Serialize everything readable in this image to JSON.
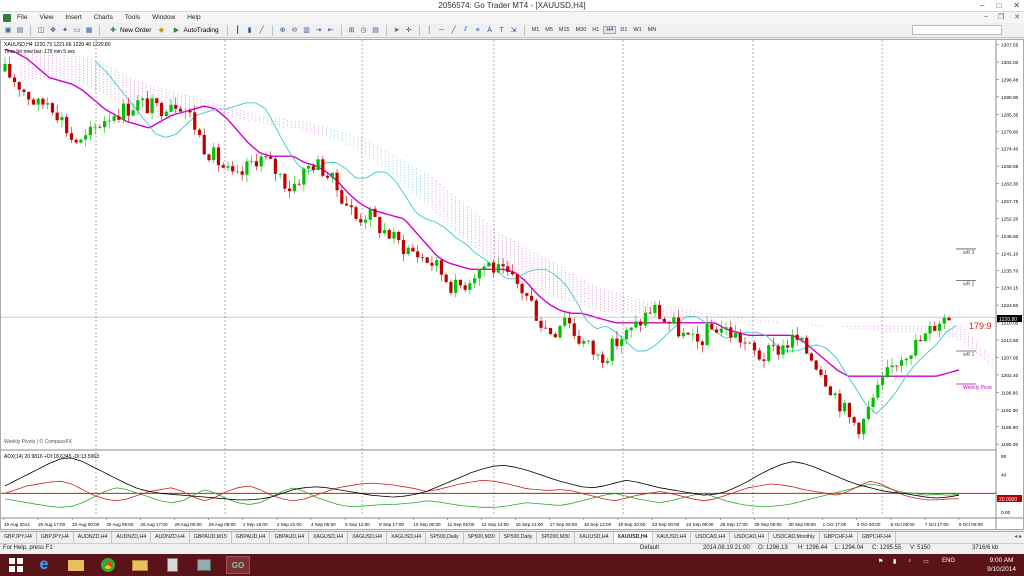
{
  "window": {
    "title": "2056574: Go Trader MT4 - [XAUUSD,H4]"
  },
  "menu": {
    "items": [
      "File",
      "View",
      "Insert",
      "Charts",
      "Tools",
      "Window",
      "Help"
    ]
  },
  "toolbar": {
    "new_order_label": "New Order",
    "autotrading_label": "AutoTrading",
    "timeframes": [
      "M1",
      "M5",
      "M15",
      "M30",
      "H1",
      "H4",
      "D1",
      "W1",
      "MN"
    ],
    "active_timeframe": "H4"
  },
  "chart": {
    "symbol_header": "XAUUSD,H4  1220.73  1221.66  1220.40  1220.80",
    "timer_text": "Time for new bar: 179 min 5 sec",
    "watermark": "Weekly Pivots | © CompassFX",
    "countdown_label": "179:9",
    "current_price_label": "1220.80",
    "pivot_labels": [
      "wR 3",
      "wR 2",
      "wR 1",
      "Weekly Pivot"
    ],
    "indicator_header": "ADX(14) 20.9816  +DI:18.6345  -DI:13.5963",
    "indicator_level_label": "20.0000"
  },
  "chart_data": {
    "type": "candlestick",
    "symbol": "XAUUSD",
    "timeframe": "H4",
    "price_axis": {
      "ticks": [
        "1307.55",
        "1302.00",
        "1296.48",
        "1290.90",
        "1285.35",
        "1279.80",
        "1274.40",
        "1268.85",
        "1263.30",
        "1257.75",
        "1252.20",
        "1246.60",
        "1241.10",
        "1235.70",
        "1230.15",
        "1224.60",
        "1219.05",
        "1213.50",
        "1207.95",
        "1202.40",
        "1196.85",
        "1191.30",
        "1185.90",
        "1180.35"
      ],
      "range": [
        1178.5,
        1309.0
      ]
    },
    "time_axis": {
      "ticks": [
        "19 Aug 2014",
        "20 Aug 17:00",
        "22 Aug 00:00",
        "25 Aug 09:00",
        "26 Aug 17:00",
        "28 Aug 00:00",
        "29 Aug 09:00",
        "1 Sep 16:00",
        "2 Sep 21:00",
        "4 Sep 05:00",
        "5 Sep 12:00",
        "8 Sep 17:00",
        "10 Sep 00:00",
        "11 Sep 05:00",
        "12 Sep 13:00",
        "15 Sep 21:00",
        "17 Sep 05:00",
        "18 Sep 12:00",
        "19 Sep 20:00",
        "23 Sep 00:00",
        "24 Sep 09:00",
        "25 Sep 17:00",
        "29 Sep 00:00",
        "30 Sep 09:00",
        "1 Oct 17:00",
        "3 Oct 00:00",
        "6 Oct 09:00",
        "7 Oct 17:00",
        "9 Oct 00:00"
      ]
    },
    "indicator_axis": {
      "ticks": [
        "60",
        "40",
        "20.0000",
        "0.00"
      ],
      "range": [
        0,
        60
      ],
      "level": 20
    },
    "series_colors": {
      "bull": "#00c000",
      "bear": "#c00000",
      "kijun": "#d000d0",
      "tenkan": "#40c8c8",
      "cloud_bear": "#d070d0",
      "cloud_bull": "#60c0c0",
      "adx": "#000000",
      "plus_di": "#2aaa2a",
      "minus_di": "#d02020",
      "level": "#b00000"
    },
    "price_anchors": [
      1299,
      1296,
      1292,
      1288,
      1290,
      1285,
      1278,
      1276,
      1280,
      1284,
      1286,
      1287,
      1289,
      1288,
      1287,
      1290,
      1289,
      1284,
      1276,
      1272,
      1268,
      1264,
      1268,
      1272,
      1270,
      1266,
      1262,
      1266,
      1270,
      1268,
      1263,
      1258,
      1252,
      1254,
      1250,
      1247,
      1244,
      1242,
      1240,
      1238,
      1234,
      1230,
      1232,
      1236,
      1238,
      1235,
      1233,
      1230,
      1225,
      1218,
      1216,
      1222,
      1215,
      1212,
      1208,
      1210,
      1214,
      1216,
      1220,
      1224,
      1220,
      1218,
      1214,
      1212,
      1216,
      1218,
      1216,
      1214,
      1210,
      1208,
      1210,
      1212,
      1214,
      1210,
      1206,
      1200,
      1194,
      1188,
      1186,
      1194,
      1200,
      1206,
      1210,
      1212,
      1215,
      1220,
      1221
    ],
    "kijun": [
      1306,
      1305,
      1303,
      1300,
      1297,
      1296,
      1295,
      1293,
      1290,
      1287,
      1285,
      1283,
      1282,
      1281,
      1283,
      1285,
      1286,
      1287,
      1288,
      1287,
      1284,
      1280,
      1276,
      1273,
      1272,
      1272,
      1272,
      1270,
      1269,
      1267,
      1264,
      1260,
      1257,
      1255,
      1254,
      1253,
      1252,
      1248,
      1244,
      1240,
      1238,
      1237,
      1236,
      1236,
      1236,
      1236,
      1235,
      1232,
      1228,
      1225,
      1223,
      1222,
      1222,
      1221,
      1220,
      1219,
      1219,
      1219,
      1219,
      1219,
      1219,
      1219,
      1219,
      1219,
      1219,
      1217,
      1216,
      1215,
      1215,
      1215,
      1215,
      1215,
      1213,
      1210,
      1207,
      1204,
      1202,
      1202,
      1202,
      1202,
      1202,
      1202,
      1202,
      1202,
      1202,
      1203,
      1204
    ],
    "tenkan": [
      1302,
      1299,
      1295,
      1291,
      1287,
      1283,
      1279,
      1278,
      1279,
      1282,
      1285,
      1286,
      1287,
      1287,
      1288,
      1289,
      1289,
      1287,
      1281,
      1275,
      1270,
      1267,
      1268,
      1270,
      1270,
      1268,
      1265,
      1265,
      1267,
      1267,
      1264,
      1259,
      1254,
      1252,
      1251,
      1249,
      1246,
      1244,
      1241,
      1239,
      1236,
      1233,
      1233,
      1235,
      1236,
      1236,
      1234,
      1231,
      1226,
      1220,
      1217,
      1218,
      1216,
      1213,
      1210,
      1210,
      1212,
      1215,
      1218,
      1221,
      1221,
      1219,
      1216,
      1214,
      1215,
      1216,
      1216,
      1215,
      1212,
      1210,
      1210,
      1211,
      1212,
      1211,
      1208,
      1203,
      1198,
      1193,
      1190,
      1193,
      1197,
      1202,
      1206,
      1209,
      1212,
      1216,
      1218
    ],
    "cloud_top": [
      1307,
      1306,
      1305,
      1305,
      1304,
      1304,
      1303,
      1302,
      1300,
      1298,
      1296,
      1295,
      1294,
      1293,
      1292,
      1291,
      1290,
      1289,
      1288,
      1287,
      1286,
      1285,
      1284,
      1284,
      1283,
      1283,
      1282,
      1281,
      1280,
      1279,
      1278,
      1276,
      1274,
      1272,
      1270,
      1268,
      1266,
      1263,
      1260,
      1257,
      1254,
      1251,
      1248,
      1246,
      1244,
      1242,
      1240,
      1238,
      1236,
      1234,
      1232,
      1230,
      1229,
      1228,
      1227,
      1226,
      1225,
      1224,
      1224,
      1223,
      1222,
      1222,
      1221,
      1221,
      1220,
      1220,
      1220,
      1219,
      1219,
      1219,
      1218,
      1218,
      1218,
      1218,
      1218,
      1218,
      1218,
      1218,
      1218,
      1218,
      1218,
      1218,
      1218,
      1218,
      1214,
      1210,
      1206
    ],
    "cloud_bottom": [
      1296,
      1296,
      1297,
      1297,
      1296,
      1295,
      1294,
      1292,
      1290,
      1288,
      1286,
      1285,
      1284,
      1284,
      1285,
      1286,
      1286,
      1286,
      1285,
      1284,
      1283,
      1283,
      1282,
      1281,
      1281,
      1280,
      1279,
      1278,
      1277,
      1275,
      1273,
      1271,
      1268,
      1265,
      1262,
      1259,
      1256,
      1252,
      1249,
      1246,
      1243,
      1240,
      1237,
      1235,
      1233,
      1231,
      1229,
      1227,
      1226,
      1225,
      1224,
      1223,
      1222,
      1222,
      1222,
      1222,
      1221,
      1221,
      1221,
      1221,
      1221,
      1221,
      1220,
      1220,
      1219,
      1219,
      1219,
      1219,
      1219,
      1219,
      1219,
      1218,
      1218,
      1217,
      1217,
      1217,
      1216,
      1216,
      1216,
      1216,
      1215,
      1215,
      1214,
      1213,
      1210,
      1207,
      1204
    ],
    "pivot_levels": {
      "wR3": 1242.5,
      "wR2": 1232.5,
      "wR1": 1210.0,
      "weekly_pivot": 1199.5
    },
    "adx": [
      28,
      34,
      40,
      46,
      52,
      57,
      58,
      54,
      48,
      42,
      36,
      30,
      25,
      22,
      20,
      19,
      18,
      17,
      16,
      15,
      14,
      13,
      13,
      14,
      16,
      20,
      24,
      26,
      27,
      26,
      24,
      22,
      20,
      18,
      17,
      16,
      17,
      19,
      22,
      27,
      32,
      37,
      42,
      46,
      49,
      50,
      48,
      45,
      41,
      37,
      33,
      30,
      27,
      26,
      28,
      31,
      34,
      32,
      29,
      26,
      24,
      22,
      20,
      18,
      19,
      22,
      27,
      33,
      40,
      46,
      51,
      54,
      52,
      48,
      43,
      38,
      33,
      29,
      26,
      23,
      21,
      20,
      18,
      16,
      15,
      16,
      18
    ],
    "plus_di": [
      14,
      12,
      10,
      8,
      6,
      5,
      6,
      10,
      16,
      22,
      26,
      24,
      20,
      16,
      12,
      10,
      12,
      18,
      24,
      20,
      14,
      10,
      8,
      10,
      16,
      22,
      26,
      22,
      16,
      12,
      8,
      6,
      6,
      7,
      8,
      8,
      9,
      10,
      12,
      11,
      9,
      7,
      6,
      5,
      5,
      6,
      8,
      10,
      9,
      8,
      7,
      9,
      12,
      15,
      18,
      20,
      17,
      14,
      12,
      10,
      12,
      15,
      18,
      20,
      16,
      12,
      9,
      7,
      6,
      6,
      7,
      9,
      12,
      15,
      18,
      21,
      24,
      27,
      30,
      28,
      24,
      21,
      20,
      18,
      19,
      18,
      19
    ],
    "minus_di": [
      20,
      24,
      28,
      30,
      32,
      33,
      30,
      24,
      18,
      14,
      12,
      14,
      18,
      22,
      24,
      26,
      22,
      16,
      12,
      16,
      22,
      26,
      28,
      24,
      18,
      14,
      12,
      14,
      18,
      22,
      26,
      28,
      30,
      31,
      30,
      29,
      27,
      25,
      22,
      24,
      27,
      30,
      32,
      34,
      33,
      31,
      28,
      25,
      24,
      23,
      24,
      23,
      20,
      17,
      14,
      12,
      15,
      18,
      20,
      22,
      20,
      17,
      14,
      12,
      14,
      18,
      22,
      26,
      28,
      30,
      29,
      27,
      24,
      22,
      20,
      18,
      22,
      28,
      33,
      30,
      24,
      18,
      15,
      13,
      13,
      14,
      14
    ]
  },
  "tabs": {
    "items": [
      "GBPJPY,H4",
      "GBPJPY,H4",
      "AUDNZD,H4",
      "AUDNZD,H4",
      "AUDNZD,H4",
      "GBPAUD,M15",
      "GBPAUD,H4",
      "GBPAUD,H4",
      "XAGUSD,H4",
      "XAGUSD,H4",
      "XAGUSD,H4",
      "SP500,Daily",
      "SP500,M30",
      "SP500,Daily",
      "SPI200,M30",
      "XAUUSD,H4",
      "XAUUSD,H4",
      "XAUUSD,H4",
      "USDCAD,H4",
      "USDCAD,H4",
      "USDCAD,Monthly",
      "GBPCHF,H4",
      "GBPCHF,H4"
    ],
    "active_index": 16
  },
  "status": {
    "help": "For Help, press F1",
    "profile": "Default",
    "datetime": "2014.08.19 21:00",
    "open": "O: 1296.13",
    "high": "H: 1296.44",
    "low": "L: 1294.04",
    "close": "C: 1295.55",
    "volume": "V: 5150",
    "traffic": "3716/6 kb"
  },
  "taskbar": {
    "tray_lang": "ENG",
    "time": "9:00 AM",
    "date": "9/10/2014"
  }
}
